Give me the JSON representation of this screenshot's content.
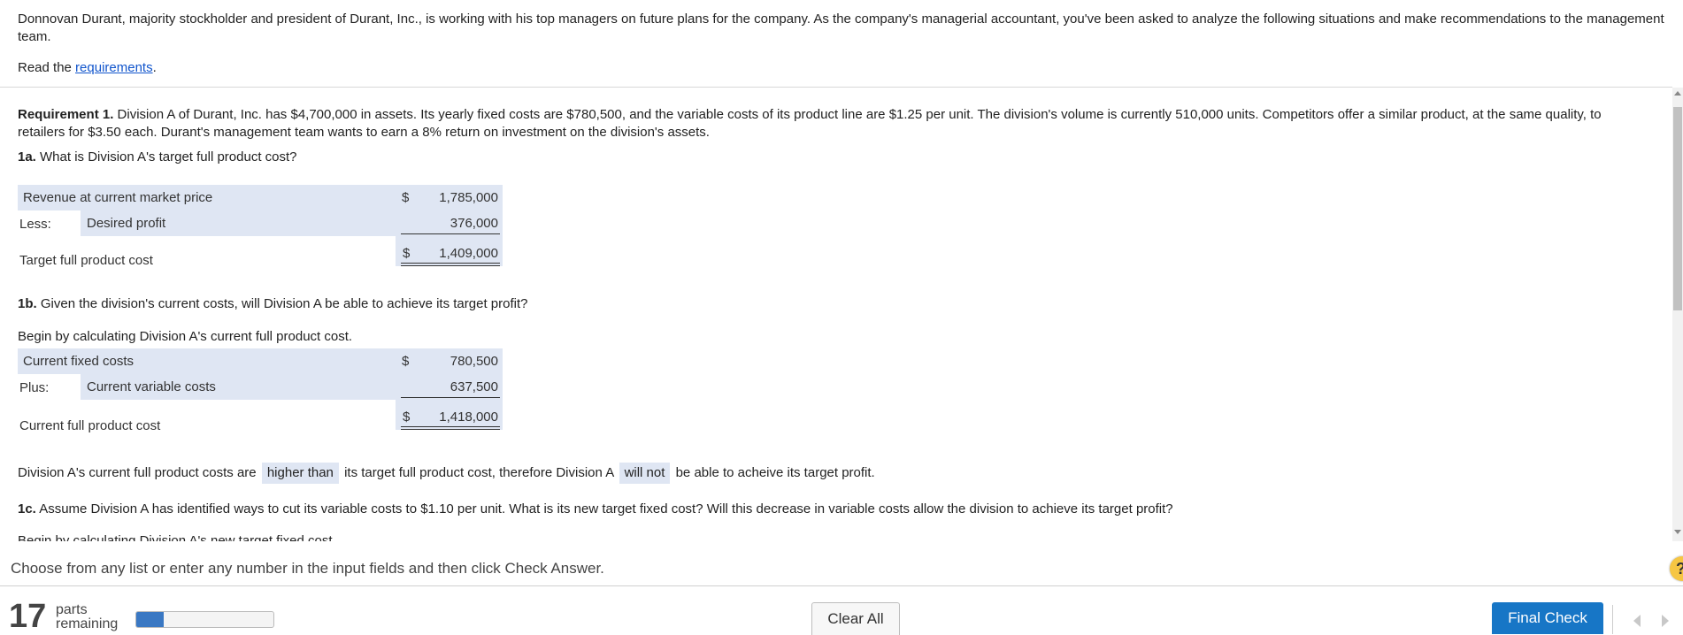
{
  "intro": {
    "text": "Donnovan Durant, majority stockholder and president of Durant, Inc., is working with his top managers on future plans for the company. As the company's managerial accountant, you've been asked to analyze the following situations and make recommendations to the management team.",
    "read_prefix": "Read the ",
    "read_link": "requirements",
    "read_suffix": "."
  },
  "requirement1": {
    "label": "Requirement 1.",
    "text": " Division A of Durant, Inc. has $4,700,000 in assets. Its yearly fixed costs are $780,500, and the variable costs of its product line are $1.25 per unit. The division's volume is currently 510,000 units. Competitors offer a similar product, at the same quality, to retailers for $3.50 each. Durant's management team wants to earn a 8% return on investment on the division's assets."
  },
  "q1a": {
    "label": "1a.",
    "text": " What is Division A's target full product cost?"
  },
  "table1a": {
    "row1_label": "Revenue at current market price",
    "row1_dollar": "$",
    "row1_value": "1,785,000",
    "row2_prefix": "Less:",
    "row2_label": "Desired profit",
    "row2_value": "376,000",
    "total_label": "Target full product cost",
    "total_dollar": "$",
    "total_value": "1,409,000"
  },
  "q1b": {
    "label": "1b.",
    "text": " Given the division's current costs, will Division A be able to achieve its target profit?"
  },
  "q1b_begin": "Begin by calculating Division A's current full product cost.",
  "table1b": {
    "row1_label": "Current fixed costs",
    "row1_dollar": "$",
    "row1_value": "780,500",
    "row2_prefix": "Plus:",
    "row2_label": "Current variable costs",
    "row2_value": "637,500",
    "total_label": "Current full product cost",
    "total_dollar": "$",
    "total_value": "1,418,000"
  },
  "sentence1b": {
    "part1": "Division A's current full product costs are",
    "choice1": "higher than",
    "part2": "its target full product cost, therefore Division A",
    "choice2": "will not",
    "part3": "be able to acheive its target profit."
  },
  "q1c": {
    "label": "1c.",
    "text": " Assume Division A has identified ways to cut its variable costs to $1.10 per unit. What is its new target fixed cost? Will this decrease in variable costs allow the division to achieve its target profit?"
  },
  "q1c_begin": "Begin by calculating Division A's new target fixed cost.",
  "footer": {
    "instruction": "Choose from any list or enter any number in the input fields and then click Check Answer.",
    "parts_count": "17",
    "parts_word": "parts",
    "remaining_word": "remaining",
    "progress_fraction": 0.2,
    "clear_all": "Clear All",
    "final_check": "Final Check",
    "help": "?"
  },
  "colors": {
    "accent": "#1776c6",
    "field_shade": "#dfe6f3",
    "progress": "#3a78c3",
    "help": "#f6c643",
    "link": "#1155cc"
  },
  "icons": {
    "help": "help-icon",
    "prev": "chevron-left-icon",
    "next": "chevron-right-icon",
    "scroll_up": "scroll-up-arrow",
    "scroll_down": "scroll-down-arrow"
  }
}
